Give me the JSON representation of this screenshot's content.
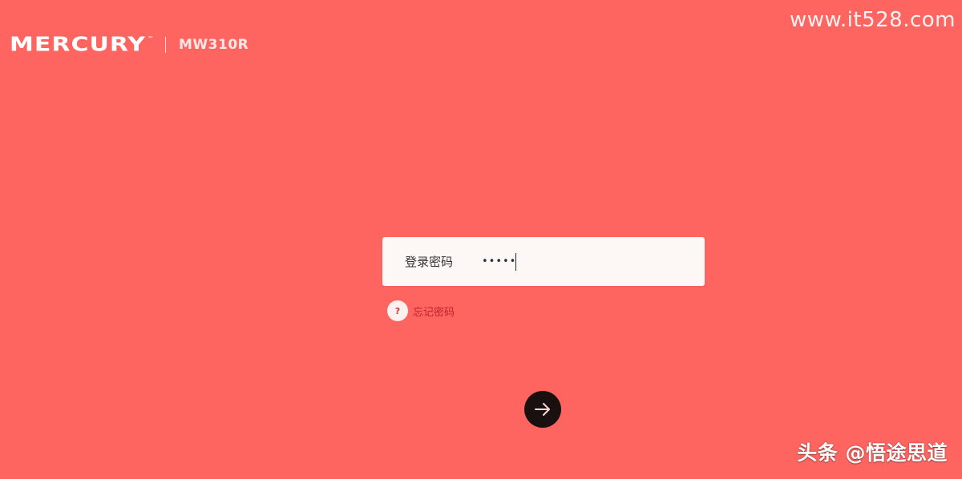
{
  "header": {
    "brand_name": "MERCURY",
    "brand_tm": "™",
    "model": "MW310R"
  },
  "watermark": {
    "top_right": "www.it528.com",
    "bottom_right": "头条 @悟途思道"
  },
  "login": {
    "label": "登录密码",
    "password_masked": "•••••",
    "forgot_icon": "?",
    "forgot_label": "忘记密码"
  },
  "icons": {
    "help": "question-icon",
    "submit": "arrow-right-icon"
  },
  "colors": {
    "background": "#fe6560",
    "input_bg": "#fdf7f6",
    "submit_bg": "#1a1010",
    "forgot_text": "#c0202c"
  }
}
